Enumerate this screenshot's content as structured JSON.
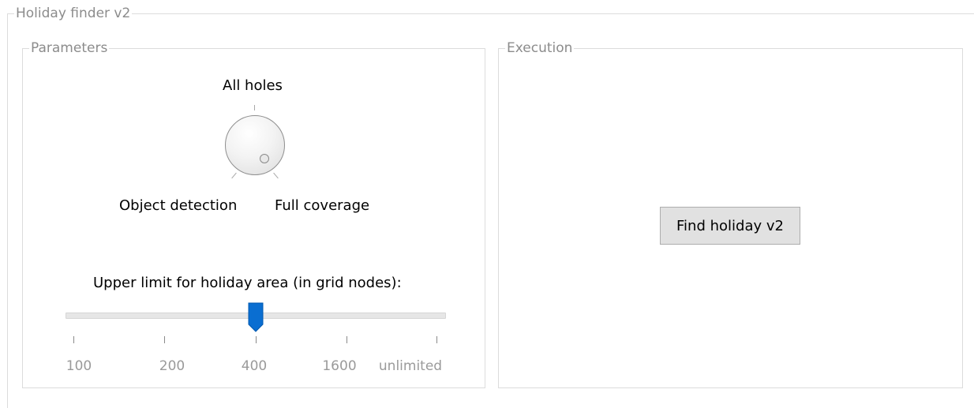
{
  "outer_group": {
    "title": "Holiday finder v2"
  },
  "parameters": {
    "title": "Parameters",
    "dial": {
      "label_top": "All holes",
      "label_left": "Object detection",
      "label_right": "Full coverage"
    },
    "slider": {
      "label": "Upper limit for holiday area (in grid nodes):",
      "tick_labels": [
        "100",
        "200",
        "400",
        "1600",
        "unlimited"
      ],
      "selected_value": "400",
      "accent_color": "#0a6ed1"
    }
  },
  "execution": {
    "title": "Execution",
    "button_label": "Find holiday v2"
  }
}
